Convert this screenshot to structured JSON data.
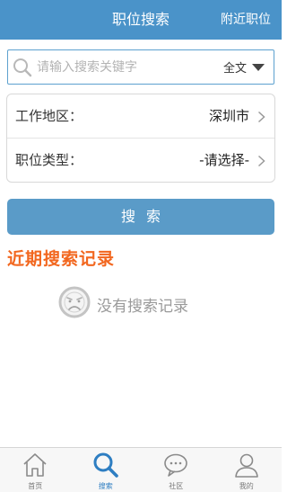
{
  "header": {
    "title": "职位搜索",
    "right_action": "附近职位"
  },
  "search": {
    "placeholder": "请输入搜索关键字",
    "scope_label": "全文"
  },
  "form": {
    "location_label": "工作地区：",
    "location_value": "深圳市",
    "type_label": "职位类型：",
    "type_value": "-请选择-"
  },
  "search_button": "搜索",
  "recent": {
    "title": "近期搜索记录",
    "empty_text": "没有搜索记录"
  },
  "tabs": [
    {
      "label": "首页",
      "icon": "home-icon"
    },
    {
      "label": "搜索",
      "icon": "search-icon"
    },
    {
      "label": "社区",
      "icon": "chat-bubble-icon"
    },
    {
      "label": "我的",
      "icon": "user-icon"
    }
  ],
  "colors": {
    "header_bg": "#4a93c9",
    "button_bg": "#5a9bc8",
    "accent_orange": "#f2671f",
    "tab_active": "#2e7ec2"
  }
}
